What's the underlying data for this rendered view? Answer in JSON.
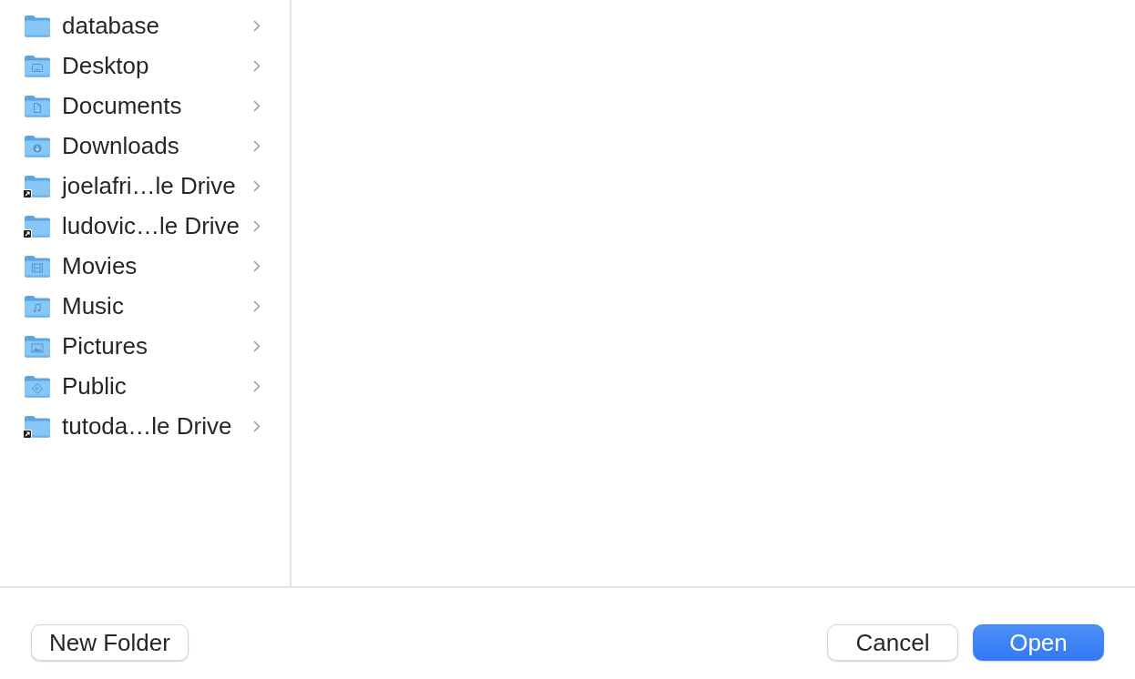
{
  "browser_column": {
    "items": [
      {
        "name": "database",
        "kind": "plain"
      },
      {
        "name": "Desktop",
        "kind": "desktop"
      },
      {
        "name": "Documents",
        "kind": "documents"
      },
      {
        "name": "Downloads",
        "kind": "downloads"
      },
      {
        "name": "joelafri…le Drive",
        "kind": "alias"
      },
      {
        "name": "ludovic…le Drive",
        "kind": "alias"
      },
      {
        "name": "Movies",
        "kind": "movies"
      },
      {
        "name": "Music",
        "kind": "music"
      },
      {
        "name": "Pictures",
        "kind": "pictures"
      },
      {
        "name": "Public",
        "kind": "public"
      },
      {
        "name": "tutoda…le Drive",
        "kind": "alias"
      }
    ]
  },
  "footer": {
    "new_folder_button": {
      "label": "New Folder"
    },
    "buttons": [
      {
        "label": "Cancel",
        "default": false
      },
      {
        "label": "Open",
        "default": true
      }
    ]
  }
}
